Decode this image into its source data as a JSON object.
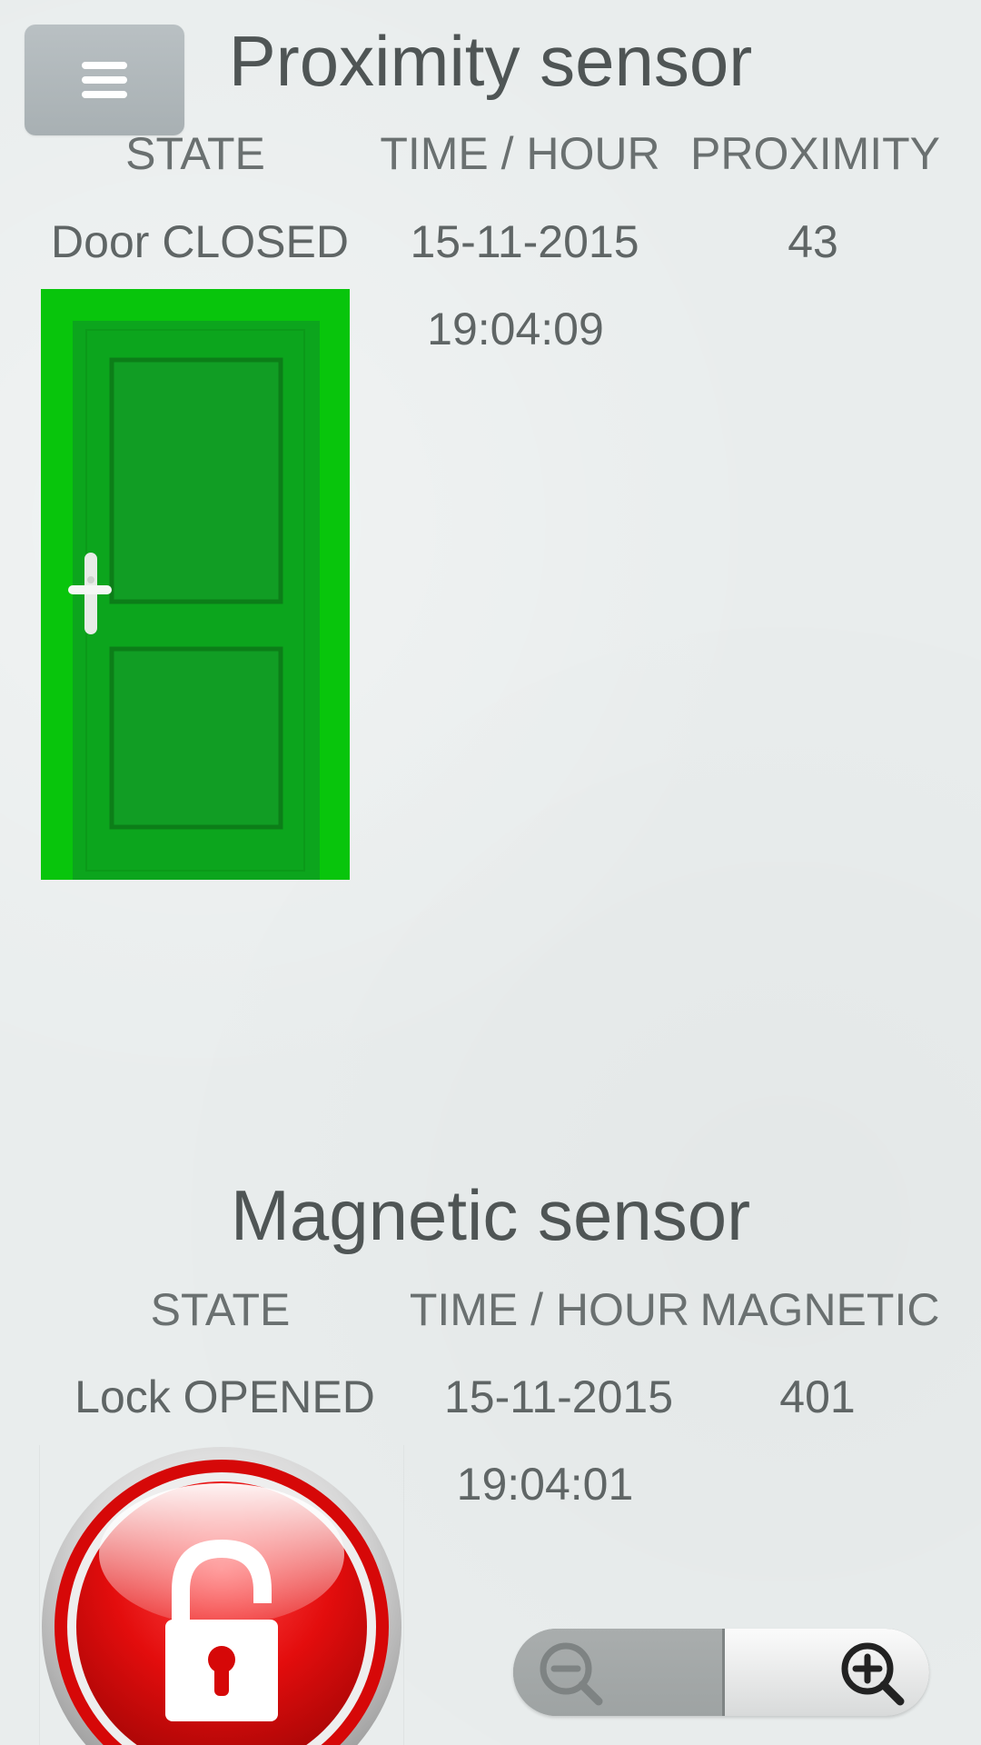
{
  "menu": {
    "icon": "hamburger-menu-icon"
  },
  "proximity": {
    "title": "Proximity sensor",
    "headers": {
      "state": "STATE",
      "time": "TIME / HOUR",
      "value": "PROXIMITY"
    },
    "state": "Door CLOSED",
    "date": "15-11-2015",
    "time": "19:04:09",
    "value": "43",
    "image": "green-door-icon"
  },
  "magnetic": {
    "title": "Magnetic sensor",
    "headers": {
      "state": "STATE",
      "time": "TIME / HOUR",
      "value": "MAGNETIC"
    },
    "state": "Lock OPENED",
    "date": "15-11-2015",
    "time": "19:04:01",
    "value": "401",
    "image": "red-unlocked-padlock-icon"
  },
  "zoom": {
    "out_icon": "zoom-out-icon",
    "in_icon": "zoom-in-icon"
  },
  "colors": {
    "background": "#e9eded",
    "door_green": "#08b80b",
    "lock_red": "#e30d0d",
    "menu_button": "#aeb5b8"
  }
}
